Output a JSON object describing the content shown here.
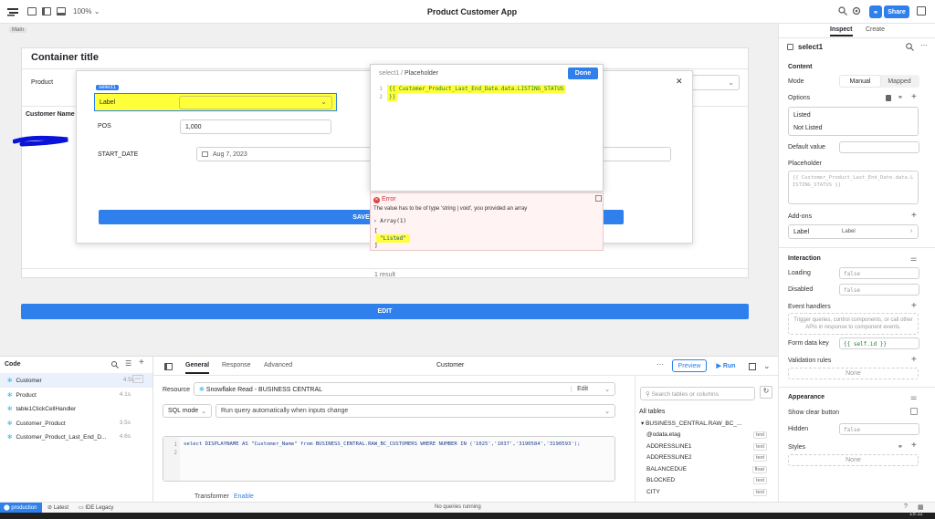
{
  "topbar": {
    "zoom": "100%",
    "app_title": "Product Customer App",
    "share": "Share"
  },
  "canvas": {
    "main_tag": "Main",
    "container_title": "Container title",
    "product_label": "Product",
    "customer_name_header": "Customer Name",
    "results": "1 result",
    "edit_button": "EDIT",
    "modal": {
      "select_tag": "select1",
      "select_label": "Label",
      "pos_label": "POS",
      "pos_value": "1,000",
      "start_date_label": "START_DATE",
      "start_date_value": "Aug 7, 2023",
      "save_button": "SAVE",
      "close": "✕"
    }
  },
  "editor": {
    "path_component": "select1",
    "path_sep": "/",
    "path_field": "Placeholder",
    "done": "Done",
    "line1": "{{ Customer_Product_Last_End_Date.data.LISTING_STATUS",
    "line2": "}}",
    "error_title": "Error",
    "error_message": "The value has to be of type 'string | void', you provided an array",
    "array_label": "Array(1)",
    "array_open": "[",
    "array_item": "\"Listed\"",
    "array_close": "]"
  },
  "inspector": {
    "tabs": [
      "Inspect",
      "Create"
    ],
    "component": "select1",
    "content_title": "Content",
    "mode_label": "Mode",
    "mode_options": [
      "Manual",
      "Mapped"
    ],
    "options_label": "Options",
    "options": [
      "Listed",
      "Not Listed"
    ],
    "default_value_label": "Default value",
    "placeholder_label": "Placeholder",
    "placeholder_value": "{{ Customer_Product_Last_End_Date.data.LISTING_STATUS }}",
    "addons_label": "Add-ons",
    "addon_name": "Label",
    "addon_value": "Label",
    "interaction_title": "Interaction",
    "loading_label": "Loading",
    "loading_value": "false",
    "disabled_label": "Disabled",
    "disabled_value": "false",
    "event_handlers_label": "Event handlers",
    "event_handlers_hint": "Trigger queries, control components, or call other APIs in response to component events.",
    "form_data_key_label": "Form data key",
    "form_data_key_value": "{{ self.id }}",
    "validation_label": "Validation rules",
    "validation_value": "None",
    "appearance_title": "Appearance",
    "show_clear_label": "Show clear button",
    "hidden_label": "Hidden",
    "hidden_value": "false",
    "styles_label": "Styles",
    "styles_value": "None"
  },
  "code": {
    "title": "Code",
    "items": [
      {
        "name": "Customer",
        "time": "4.5s"
      },
      {
        "name": "Product",
        "time": "4.1s"
      },
      {
        "name": "table1ClickCellHandler",
        "time": ""
      },
      {
        "name": "Customer_Product",
        "time": "3.5s"
      },
      {
        "name": "Customer_Product_Last_End_D...",
        "time": "4.6s"
      }
    ]
  },
  "query": {
    "tabs": [
      "General",
      "Response",
      "Advanced"
    ],
    "name": "Customer",
    "preview": "Preview",
    "run": "Run",
    "resource_label": "Resource",
    "resource_value": "Snowflake Read - BUSINESS CENTRAL",
    "edit": "Edit",
    "mode": "SQL mode",
    "run_mode": "Run query automatically when inputs change",
    "sql_line1_num": "1",
    "sql_line2_num": "2",
    "sql": "select DISPLAYNAME AS \"Customer_Name\" from BUSINESS_CENTRAL.RAW_BC_CUSTOMERS WHERE NUMBER IN ('1025','1037','3190584','3190593');",
    "transformer": "Transformer",
    "enable": "Enable"
  },
  "tables": {
    "search_placeholder": "Search tables or columns",
    "all_tables": "All tables",
    "table_name": "BUSINESS_CENTRAL.RAW_BC_...",
    "columns": [
      {
        "name": "@odata.etag",
        "type": "text"
      },
      {
        "name": "ADDRESSLINE1",
        "type": "text"
      },
      {
        "name": "ADDRESSLINE2",
        "type": "text"
      },
      {
        "name": "BALANCEDUE",
        "type": "float"
      },
      {
        "name": "BLOCKED",
        "type": "text"
      },
      {
        "name": "CITY",
        "type": "text"
      }
    ]
  },
  "status": {
    "env": "production",
    "latest": "Latest",
    "legacy": "IDE Legacy",
    "queries": "No queries running",
    "time": "15:11"
  },
  "colors": {
    "accent": "#2f80ed",
    "highlight": "#ffff3a",
    "error": "#d64545"
  }
}
